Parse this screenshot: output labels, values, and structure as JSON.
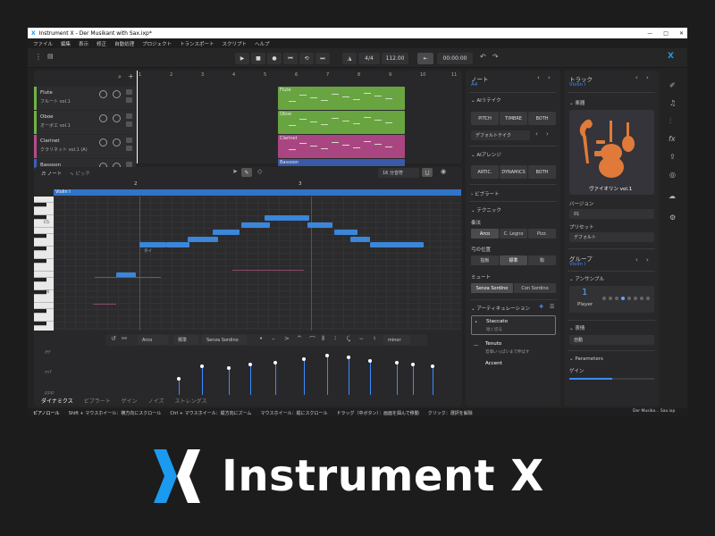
{
  "window": {
    "title": "Instrument X - Der Musikant with Sax.ixp*",
    "min": "—",
    "max": "□",
    "close": "✕"
  },
  "menu": [
    "ファイル",
    "編集",
    "表示",
    "修正",
    "自動処理",
    "プロジェクト",
    "トランスポート",
    "スクリプト",
    "ヘルプ"
  ],
  "transport": {
    "time_sig": "4/4",
    "tempo": "112.00",
    "time": "00:00:00"
  },
  "tracks": [
    {
      "name": "Flute",
      "sub": "フルート vol.1",
      "color": "#6fb344"
    },
    {
      "name": "Oboe",
      "sub": "オーボエ vol.1",
      "color": "#6fb344"
    },
    {
      "name": "Clarinet",
      "sub": "クラリネット vol.1 (A)",
      "color": "#b74a8c"
    },
    {
      "name": "Bassoon",
      "sub": "",
      "color": "#3d5fb5"
    }
  ],
  "arrange_clips": [
    "Flute",
    "Oboe",
    "Clarinet",
    "Bassoon"
  ],
  "ruler": [
    "1",
    "2",
    "3",
    "4",
    "5",
    "6",
    "7",
    "8",
    "9",
    "10",
    "11"
  ],
  "editor": {
    "tab_note": "ノート",
    "tab_pitch": "ピッチ",
    "quant": "16 分音符",
    "region": "Violin I",
    "bar2": "2",
    "bar3": "3",
    "c5": "C5",
    "c4": "C4",
    "tie": "タイ"
  },
  "bottom_bar": {
    "sel1": "Arco",
    "sel2": "標準",
    "sel3": "Senza Sordino",
    "key": "minor"
  },
  "dyn": {
    "ff": "fff",
    "mf": "mf",
    "ppp": "ppp"
  },
  "lanes": [
    "ダイナミクス",
    "ビブラート",
    "ゲイン",
    "ノイズ",
    "ストレングス"
  ],
  "status": {
    "left": "ピアノロール",
    "hints": [
      "Shift + マウスホイール：横方向にスクロール",
      "Ctrl + マウスホイール：縦方向にズーム",
      "マウスホイール：縦にスクロール",
      "ドラッグ（中ボタン）：画面を掴んで移動",
      "クリック：選択を解除"
    ],
    "right": "Der Musika... Sax.ixp"
  },
  "note_panel": {
    "title": "ノート",
    "sub": "A4",
    "ai_retake": "AIリテイク",
    "tiles": [
      "PITCH",
      "TIMBRE",
      "BOTH"
    ],
    "default_take": "デフォルトテイク",
    "ai_arrange": "AIアレンジ",
    "tiles2": [
      "ARTIC.",
      "DYNAMICS",
      "BOTH"
    ],
    "vibrato": "ビブラート",
    "technique": "テクニック",
    "bow": "奏法",
    "bow_opts": [
      "Arco",
      "C. Legno",
      "Pizz."
    ],
    "pos": "弓の位置",
    "pos_opts": [
      "指板",
      "標準",
      "駒"
    ],
    "mute": "ミュート",
    "mute_opts": [
      "Senza Sordino",
      "Con Sordino"
    ],
    "artic": "アーティキュレーション",
    "a1": "Staccato",
    "a1s": "短く切る",
    "a2": "Tenuto",
    "a2s": "音価いっぱいまで伸ばす",
    "a3": "Accent"
  },
  "track_panel": {
    "title": "トラック",
    "sub": "Violin I",
    "inst": "楽器",
    "inst_name": "ヴァイオリン vol.1",
    "version_lbl": "バージョン",
    "version": "01",
    "preset_lbl": "プリセット",
    "preset": "デフォルト",
    "group": "グループ",
    "group_sub": "Violin I",
    "ensemble": "アンサンブル",
    "players": "1",
    "player_lbl": "Player",
    "expr": "表情",
    "expr_val": "自動",
    "params": "Parameters",
    "gain": "ゲイン"
  },
  "brand": {
    "name": "Instrument X",
    "accent": "#1a9bf0"
  }
}
